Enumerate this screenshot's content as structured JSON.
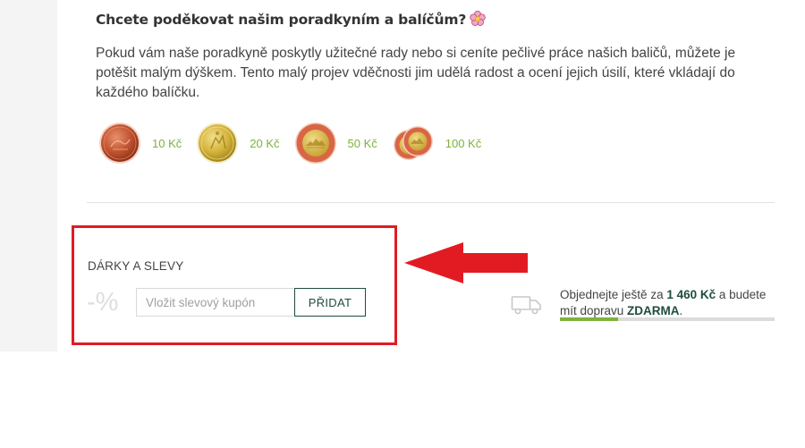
{
  "tip_section": {
    "title": "Chcete poděkovat našim poradkyním a balíčům?",
    "description": "Pokud vám naše poradkyně poskytly užitečné rady nebo si ceníte pečlivé práce našich baličů, můžete je potěšit malým dýškem. Tento malý projev vděčnosti jim udělá radost a ocení jejich úsilí, které vkládají do každého balíčku.",
    "options": [
      {
        "label": "10 Kč",
        "coin_icon": "coin-10-icon"
      },
      {
        "label": "20 Kč",
        "coin_icon": "coin-20-icon"
      },
      {
        "label": "50 Kč",
        "coin_icon": "coin-50-icon"
      },
      {
        "label": "100 Kč",
        "coin_icon": "coins-100-icon"
      }
    ]
  },
  "discount_section": {
    "title": "DÁRKY A SLEVY",
    "percent_icon_text": "-%",
    "coupon_placeholder": "Vložit slevový kupón",
    "coupon_value": "",
    "add_label": "PŘIDAT"
  },
  "shipping": {
    "text_prefix": "Objednejte ještě za ",
    "amount": "1 460 Kč",
    "text_middle": " a budete mít dopravu ",
    "free_label": "ZDARMA",
    "text_suffix": ".",
    "progress": 0.27
  },
  "colors": {
    "accent_green": "#7cb33a",
    "dark_green": "#1f4d3d",
    "highlight_red": "#e21b23",
    "arrow_red": "#e21b23"
  }
}
